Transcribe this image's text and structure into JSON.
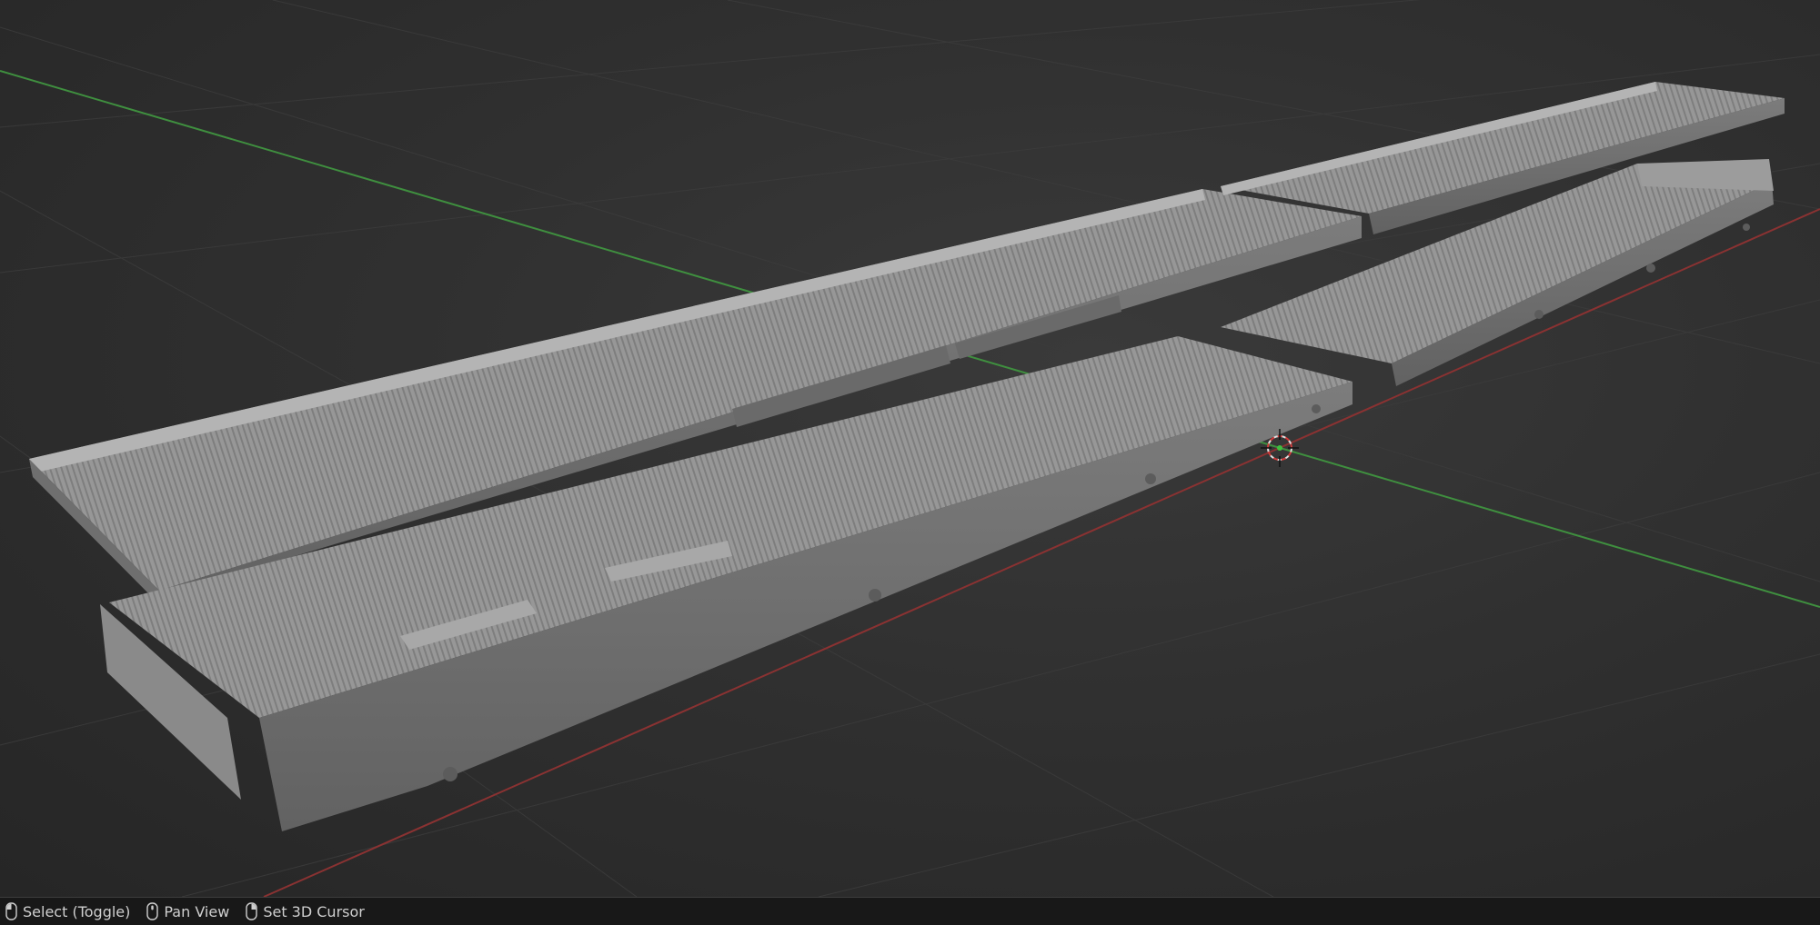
{
  "viewport": {
    "background_color": "#303030",
    "axis_x_color": "#b33a3a",
    "axis_y_color": "#3f9a3f",
    "model_color": "#9a9a9a"
  },
  "statusbar": {
    "hints": [
      {
        "icon": "mouse-left-icon",
        "label": "Select (Toggle)"
      },
      {
        "icon": "mouse-middle-icon",
        "label": "Pan View"
      },
      {
        "icon": "mouse-right-icon",
        "label": "Set 3D Cursor"
      }
    ]
  }
}
